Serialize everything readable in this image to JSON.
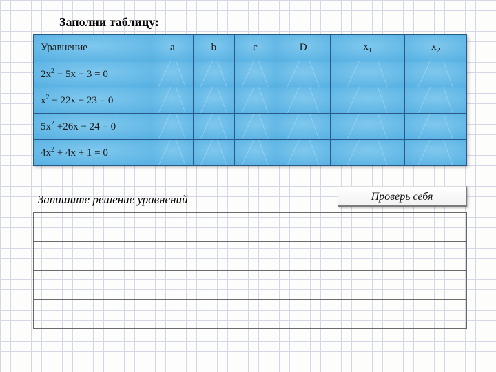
{
  "title": "Заполни таблицу:",
  "subtitle": "Запишите решение уравнений",
  "check_button": "Проверь себя",
  "headers": {
    "equation": "Уравнение",
    "a": "a",
    "b": "b",
    "c": "c",
    "d": "D",
    "x1_base": "x",
    "x1_sub": "1",
    "x2_base": "x",
    "x2_sub": "2"
  },
  "rows": [
    {
      "pre": "2x",
      "sup": "2",
      "post": " − 5x − 3 = 0"
    },
    {
      "pre": "x",
      "sup": "2",
      "post": " − 22x − 23 = 0"
    },
    {
      "pre": "5x",
      "sup": "2",
      "post": " +26x − 24 = 0"
    },
    {
      "pre": "4x",
      "sup": "2",
      "post": " + 4x + 1 = 0"
    }
  ],
  "answer_rows": 4,
  "chart_data": {
    "type": "table",
    "headers": [
      "Уравнение",
      "a",
      "b",
      "c",
      "D",
      "x1",
      "x2"
    ],
    "equations": [
      "2x² − 5x − 3 = 0",
      "x² − 22x − 23 = 0",
      "5x² + 26x − 24 = 0",
      "4x² + 4x + 1 = 0"
    ],
    "note": "Cells for a, b, c, D, x1, x2 are blank (to be filled by student)"
  }
}
